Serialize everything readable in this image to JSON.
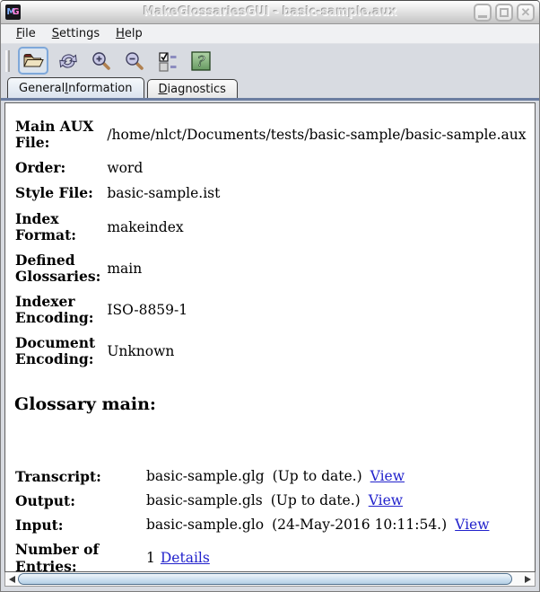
{
  "window": {
    "title": "MakeGlossariesGUI - basic-sample.aux",
    "icon": {
      "m": "M",
      "g": "G"
    },
    "controls": [
      "minimize",
      "maximize",
      "close"
    ]
  },
  "menu_bar": {
    "items": [
      {
        "pre": "",
        "mn": "F",
        "post": "ile"
      },
      {
        "pre": "",
        "mn": "S",
        "post": "ettings"
      },
      {
        "pre": "",
        "mn": "H",
        "post": "elp"
      }
    ]
  },
  "toolbar": {
    "buttons": [
      {
        "icon": "open-folder-icon",
        "action": "open"
      },
      {
        "icon": "reload-icon",
        "action": "reload"
      },
      {
        "icon": "zoom-in-icon",
        "action": "zoom-in"
      },
      {
        "icon": "zoom-out-icon",
        "action": "zoom-out"
      },
      {
        "icon": "select-options-icon",
        "action": "toggle-options"
      },
      {
        "icon": "help-icon",
        "action": "help"
      }
    ]
  },
  "tabs": [
    {
      "pre": "General ",
      "mn": "I",
      "post": "nformation",
      "selected": true
    },
    {
      "pre": "",
      "mn": "D",
      "post": "iagnostics",
      "selected": false
    }
  ],
  "general_info": {
    "fields": [
      {
        "label": "Main AUX File:",
        "value": "/home/nlct/Documents/tests/basic-sample/basic-sample.aux"
      },
      {
        "label": "Order:",
        "value": "word"
      },
      {
        "label": "Style File:",
        "value": "basic-sample.ist"
      },
      {
        "label": "Index Format:",
        "value": "makeindex"
      },
      {
        "label": "Defined Glossaries:",
        "value": "main"
      },
      {
        "label": "Indexer Encoding:",
        "value": "ISO-8859-1"
      },
      {
        "label": "Document Encoding:",
        "value": "Unknown"
      }
    ],
    "glossary": {
      "heading": "Glossary main:",
      "rows": [
        {
          "label": "Transcript:",
          "value": "basic-sample.glg",
          "status": "(Up to date.)",
          "link": "View"
        },
        {
          "label": "Output:",
          "value": "basic-sample.gls",
          "status": "(Up to date.)",
          "link": "View"
        },
        {
          "label": "Input:",
          "value": "basic-sample.glo",
          "status": "(24-May-2016 10:11:54.)",
          "link": "View"
        },
        {
          "label": "Number of Entries:",
          "value": "1",
          "status": "",
          "link": "Details"
        }
      ]
    }
  },
  "colors": {
    "link": "#2222cc",
    "tab_accent_line": "#6b7da0",
    "scrollbar_thumb": "#cde0f0",
    "help_icon_green": "#7fae77",
    "focus_ring": "#7fa8d9",
    "titlebar_gradient_top": "#ffffff",
    "titlebar_gradient_bottom": "#c3c3c3"
  }
}
